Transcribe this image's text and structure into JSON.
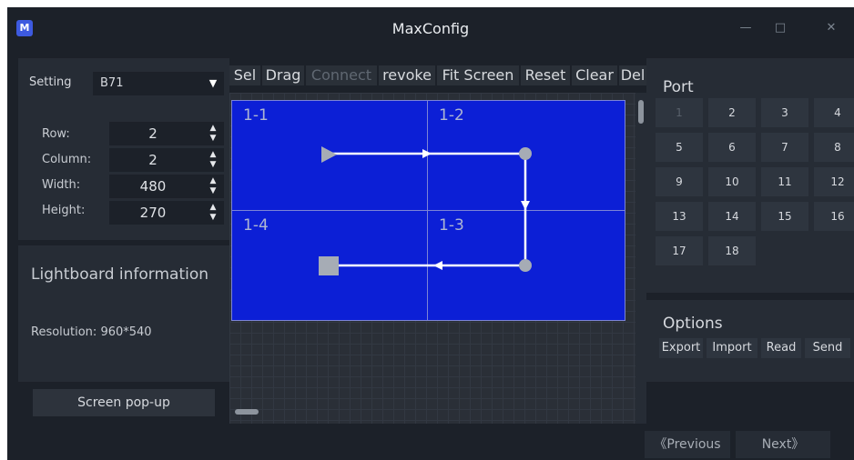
{
  "window": {
    "title": "MaxConfig",
    "icon_letter": "M",
    "minimize": "—",
    "maximize": "□",
    "close": "✕"
  },
  "settings": {
    "setting_label": "Setting",
    "setting_value": "B71",
    "fields": [
      {
        "label": "Row:",
        "value": "2"
      },
      {
        "label": "Column:",
        "value": "2"
      },
      {
        "label": "Width:",
        "value": "480"
      },
      {
        "label": "Height:",
        "value": "270"
      }
    ]
  },
  "info": {
    "title": "Lightboard information",
    "resolution_label": "Resolution:",
    "resolution_value": "960*540"
  },
  "popup_button": "Screen pop-up",
  "toolbar": [
    "Sel",
    "Drag",
    "Connect",
    "revoke",
    "Fit Screen",
    "Reset",
    "Clear",
    "Del"
  ],
  "boards": [
    "1-1",
    "1-2",
    "1-3",
    "1-4"
  ],
  "port": {
    "title": "Port",
    "cells": [
      "1",
      "2",
      "3",
      "4",
      "5",
      "6",
      "7",
      "8",
      "9",
      "10",
      "11",
      "12",
      "13",
      "14",
      "15",
      "16",
      "17",
      "18"
    ]
  },
  "options": {
    "title": "Options",
    "buttons": [
      "Export",
      "Import",
      "Read",
      "Send"
    ]
  },
  "nav": {
    "previous": "《Previous",
    "next": "Next》"
  },
  "colors": {
    "board": "#0c1fd6",
    "background": "#1c2129",
    "panel": "#262c35",
    "wire": "#ffffff"
  }
}
